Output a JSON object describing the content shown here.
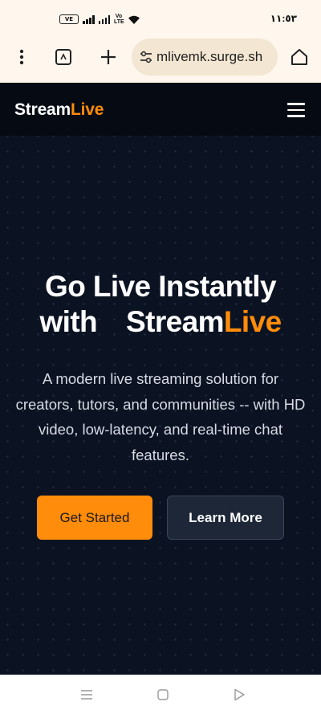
{
  "status_bar": {
    "battery": "VE",
    "network_label": "Vo LTE",
    "time": "١١:٥٣"
  },
  "browser": {
    "url": "mlivemk.surge.sh"
  },
  "site": {
    "logo": {
      "part1": "Stream",
      "part2": "Live"
    },
    "hero": {
      "title_line1": "Go Live Instantly",
      "title_line2_prefix": "with",
      "title_brand_part1": "Stream",
      "title_brand_part2": "Live",
      "subtitle": "A modern live streaming solution for creators, tutors, and communities -- with HD video, low-latency, and real-time chat features."
    },
    "buttons": {
      "primary": "Get Started",
      "secondary": "Learn More"
    }
  },
  "colors": {
    "accent": "#ff8c0a",
    "site_background": "#0b1322",
    "nav_background": "#050a13",
    "browser_chrome": "#fff7ee"
  }
}
